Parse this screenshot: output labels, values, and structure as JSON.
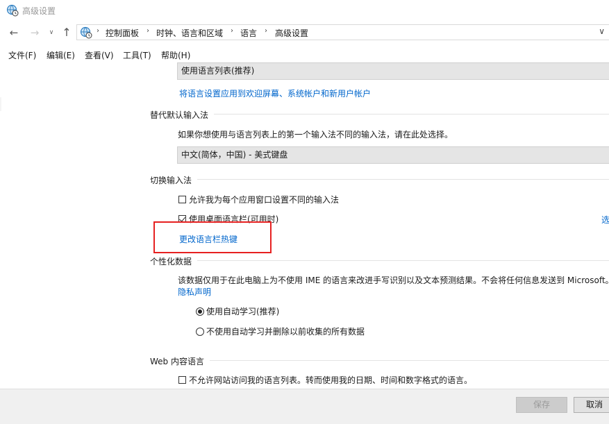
{
  "window": {
    "title": "高级设置"
  },
  "address": {
    "crumbs": [
      "控制面板",
      "时钟、语言和区域",
      "语言",
      "高级设置"
    ],
    "separator": "›"
  },
  "menu": {
    "items": [
      "文件(F)",
      "编辑(E)",
      "查看(V)",
      "工具(T)",
      "帮助(H)"
    ]
  },
  "display_language": {
    "selected": "使用语言列表(推荐)",
    "apply_link": "将语言设置应用到欢迎屏幕、系统帐户和新用户帐户"
  },
  "override_input": {
    "title": "替代默认输入法",
    "description": "如果你想使用与语言列表上的第一个输入法不同的输入法，请在此处选择。",
    "selected": "中文(简体，中国) - 美式键盘"
  },
  "switch_input": {
    "title": "切换输入法",
    "option_per_app": "允许我为每个应用窗口设置不同的输入法",
    "option_per_app_checked": false,
    "option_desktop_bar": "使用桌面语言栏(可用时)",
    "option_desktop_bar_checked": true,
    "options_link_partial": "选",
    "hotkeys_link": "更改语言栏热键"
  },
  "personalization": {
    "title": "个性化数据",
    "description": "该数据仅用于在此电脑上为不使用 IME 的语言来改进手写识别以及文本预测结果。不会将任何信息发送到 Microsoft。",
    "privacy_link": "隐私声明",
    "radio_auto": "使用自动学习(推荐)",
    "radio_auto_selected": true,
    "radio_no_auto": "不使用自动学习并删除以前收集的所有数据",
    "radio_no_auto_selected": false
  },
  "web_language": {
    "title": "Web 内容语言",
    "option": "不允许网站访问我的语言列表。转而使用我的日期、时间和数字格式的语言。",
    "option_checked": false
  },
  "buttons": {
    "save": "保存",
    "cancel": "取消"
  },
  "icons": {
    "app": "globe-clock-icon",
    "back": "arrow-left-icon",
    "forward": "arrow-right-icon",
    "recent": "chevron-down-icon",
    "up": "arrow-up-icon"
  },
  "colors": {
    "link": "#0066cc",
    "highlight": "#e62020"
  }
}
